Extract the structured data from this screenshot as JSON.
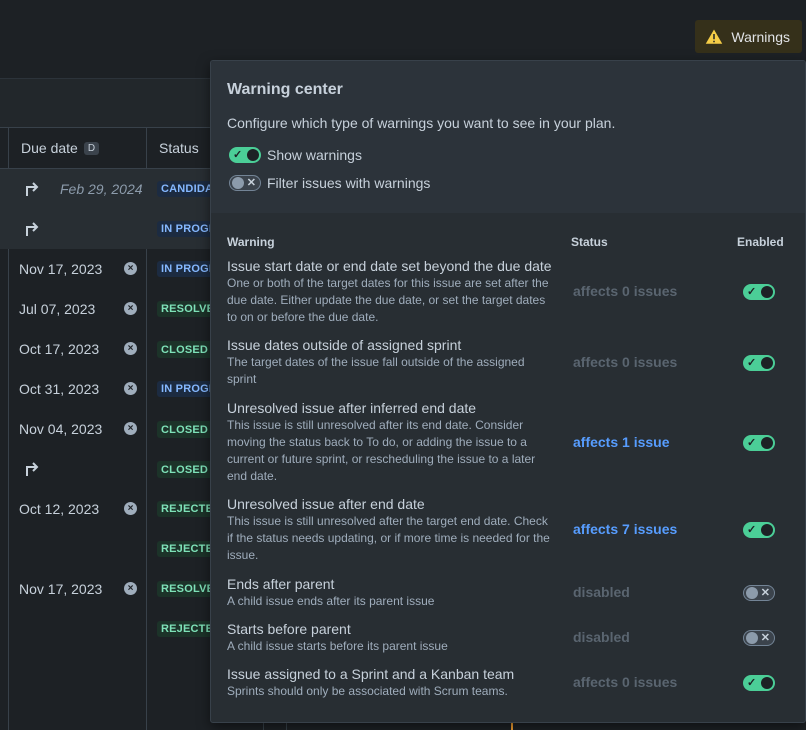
{
  "toolbar": {
    "warnings_label": "Warnings"
  },
  "table": {
    "headers": {
      "due_date": "Due date",
      "due_date_key": "D",
      "status": "Status"
    },
    "rows": [
      {
        "date": "Feb 29, 2024",
        "status": "CANDIDA",
        "status_color": "blue",
        "arrow": true,
        "inferred": true
      },
      {
        "date": "",
        "status": "IN PROGR",
        "status_color": "blue",
        "arrow": true
      },
      {
        "date": "Nov 17, 2023",
        "status": "IN PROGR",
        "status_color": "blue"
      },
      {
        "date": "Jul 07, 2023",
        "status": "RESOLVE",
        "status_color": "green"
      },
      {
        "date": "Oct 17, 2023",
        "status": "CLOSED ⌄",
        "status_color": "green"
      },
      {
        "date": "Oct 31, 2023",
        "status": "IN PROGR",
        "status_color": "blue"
      },
      {
        "date": "Nov 04, 2023",
        "status": "CLOSED ⌄",
        "status_color": "green"
      },
      {
        "date": "",
        "status": "CLOSED ⌄",
        "status_color": "green",
        "arrow": true
      },
      {
        "date": "Oct 12, 2023",
        "status": "REJECTED",
        "status_color": "green"
      },
      {
        "date": "",
        "status": "REJECTED",
        "status_color": "green"
      },
      {
        "date": "Nov 17, 2023",
        "status": "RESOLVE",
        "status_color": "green"
      },
      {
        "date": "",
        "status": "REJECTED",
        "status_color": "green"
      }
    ]
  },
  "warning_center": {
    "title": "Warning center",
    "description": "Configure which type of warnings you want to see in your plan.",
    "show_warnings": {
      "label": "Show warnings",
      "on": true
    },
    "filter_issues": {
      "label": "Filter issues with warnings",
      "on": false
    },
    "columns": {
      "warning": "Warning",
      "status": "Status",
      "enabled": "Enabled"
    },
    "items": [
      {
        "title": "Issue start date or end date set beyond the due date",
        "desc": "One or both of the target dates for this issue are set after the due date. Either update the due date, or set the target dates to on or before the due date.",
        "status": "affects 0 issues",
        "status_kind": "muted",
        "enabled": true
      },
      {
        "title": "Issue dates outside of assigned sprint",
        "desc": "The target dates of the issue fall outside of the assigned sprint",
        "status": "affects 0 issues",
        "status_kind": "muted",
        "enabled": true
      },
      {
        "title": "Unresolved issue after inferred end date",
        "desc": "This issue is still unresolved after its end date. Consider moving the status back to To do, or adding the issue to a current or future sprint, or rescheduling the issue to a later end date.",
        "status": "affects 1 issue",
        "status_kind": "link",
        "enabled": true
      },
      {
        "title": "Unresolved issue after end date",
        "desc": "This issue is still unresolved after the target end date. Check if the status needs updating, or if more time is needed for the issue.",
        "status": "affects 7 issues",
        "status_kind": "link",
        "enabled": true
      },
      {
        "title": "Ends after parent",
        "desc": "A child issue ends after its parent issue",
        "status": "disabled",
        "status_kind": "muted",
        "enabled": false
      },
      {
        "title": "Starts before parent",
        "desc": "A child issue starts before its parent issue",
        "status": "disabled",
        "status_kind": "muted",
        "enabled": false
      },
      {
        "title": "Issue assigned to a Sprint and a Kanban team",
        "desc": "Sprints should only be associated with Scrum teams.",
        "status": "affects 0 issues",
        "status_kind": "muted",
        "enabled": true
      }
    ]
  }
}
